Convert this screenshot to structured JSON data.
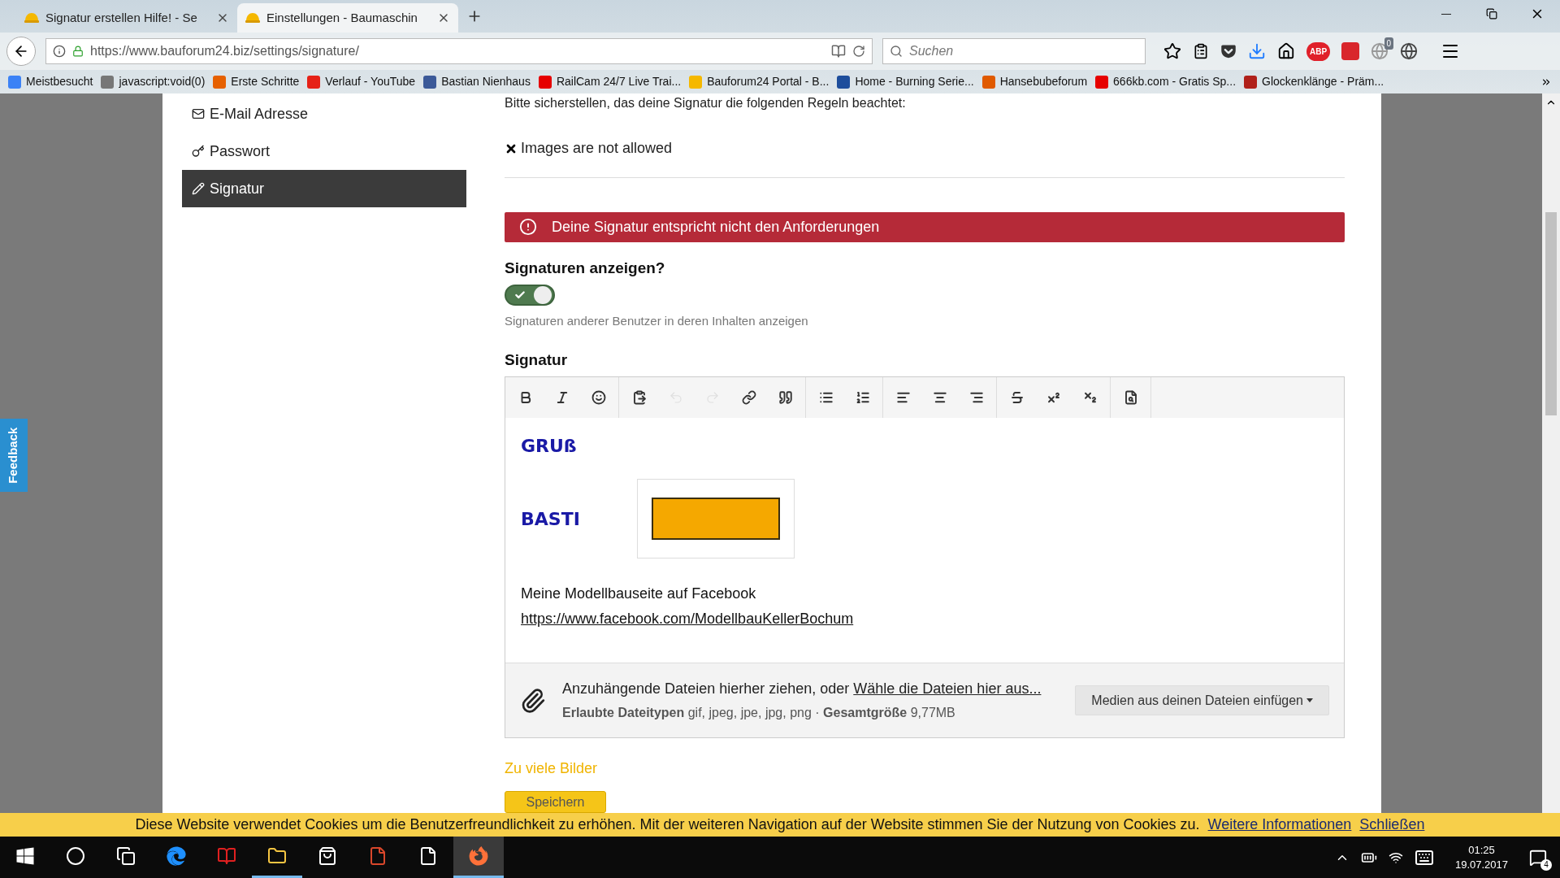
{
  "browser": {
    "tabs": [
      {
        "title": "Signatur erstellen Hilfe! - Se",
        "selected": false
      },
      {
        "title": "Einstellungen - Baumaschin",
        "selected": true
      }
    ],
    "url": "https://www.bauforum24.biz/settings/signature/",
    "search": {
      "placeholder": "Suchen"
    },
    "abp": "ABP",
    "badge": "0",
    "bookmarks": [
      "Meistbesucht",
      "javascript:void(0)",
      "Erste Schritte",
      "Verlauf - YouTube",
      "Bastian Nienhaus",
      "RailCam 24/7 Live Trai...",
      "Bauforum24 Portal - B...",
      "Home - Burning Serie...",
      "Hansebubeforum",
      "666kb.com - Gratis Sp...",
      "Glockenklänge - Präm..."
    ]
  },
  "feedback": "Feedback",
  "sidebar": {
    "items": [
      {
        "label": "E-Mail Adresse",
        "selected": false
      },
      {
        "label": "Passwort",
        "selected": false
      },
      {
        "label": "Signatur",
        "selected": true
      }
    ]
  },
  "rules": {
    "intro": "Bitte sicherstellen, das deine Signatur die folgenden Regeln beachtet:",
    "items": [
      "Images are not allowed"
    ]
  },
  "alert": "Deine Signatur entspricht nicht den Anforderungen",
  "show_signatures": {
    "heading": "Signaturen anzeigen?",
    "on": true,
    "hint": "Signaturen anderer Benutzer in deren Inhalten anzeigen"
  },
  "editor": {
    "heading": "Signatur",
    "toolbar": [
      [
        {
          "disabled": false
        },
        {
          "disabled": false
        },
        {
          "disabled": false
        }
      ],
      [
        {
          "disabled": false
        },
        {
          "disabled": true
        },
        {
          "disabled": true
        },
        {
          "disabled": false
        },
        {
          "disabled": false
        }
      ],
      [
        {
          "disabled": false
        },
        {
          "disabled": false
        }
      ],
      [
        {
          "disabled": false
        },
        {
          "disabled": false
        },
        {
          "disabled": false
        }
      ],
      [
        {
          "disabled": false
        },
        {
          "disabled": false
        },
        {
          "disabled": false
        }
      ],
      [
        {
          "disabled": false
        }
      ]
    ],
    "greeting": "GRUß",
    "name": "BASTI",
    "line": "Meine Modellbauseite auf Facebook",
    "link": "https://www.facebook.com/ModellbauKellerBochum"
  },
  "attachments": {
    "text": "Anzuhängende Dateien hierher ziehen, oder",
    "link": "Wähle die Dateien hier aus...",
    "info": "**Erlaubte Dateitypen** gif, jpeg, jpe, jpg, png · **Gesamtgröße** 9,77MB",
    "button": "Medien aus deinen Dateien einfügen"
  },
  "warning": "Zu viele Bilder",
  "save": "Speichern",
  "cookie_bar": {
    "text": "Diese Website verwendet Cookies um die Benutzerfreundlichkeit zu erhöhen. Mit der weiteren Navigation auf der Website stimmen Sie der Nutzung von Cookies zu.",
    "more": "Weitere Informationen",
    "close": "Schließen"
  },
  "taskbar": {
    "apps": [
      {
        "running": false,
        "selected": false
      },
      {
        "running": false,
        "selected": false
      },
      {
        "running": false,
        "selected": false
      },
      {
        "running": false,
        "selected": false
      },
      {
        "running": false,
        "selected": false
      },
      {
        "running": true,
        "selected": false
      },
      {
        "running": false,
        "selected": false
      },
      {
        "running": false,
        "selected": false
      },
      {
        "running": false,
        "selected": false
      },
      {
        "running": true,
        "selected": true
      }
    ],
    "time": "01:25",
    "date": "19.07.2017",
    "notifications": "4"
  }
}
